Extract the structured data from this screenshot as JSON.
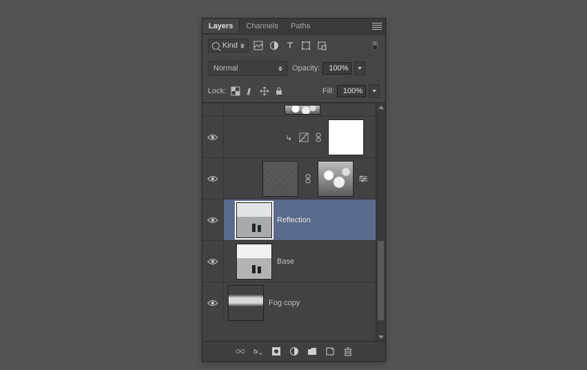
{
  "tabs": {
    "layers": "Layers",
    "channels": "Channels",
    "paths": "Paths"
  },
  "filter": {
    "label": "Kind"
  },
  "blend": {
    "mode": "Normal",
    "opacity_label": "Opacity:",
    "opacity_value": "100%"
  },
  "lock": {
    "label": "Lock:",
    "fill_label": "Fill:",
    "fill_value": "100%"
  },
  "layers": {
    "reflection": "Reflection",
    "base": "Base",
    "fogcopy": "Fog copy"
  }
}
